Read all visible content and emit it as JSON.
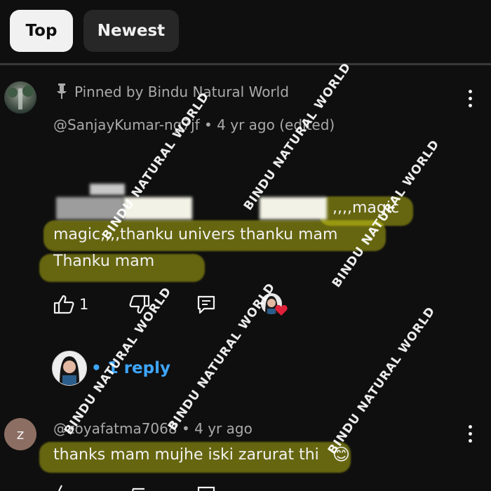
{
  "filters": {
    "top_label": "Top",
    "newest_label": "Newest"
  },
  "pinned_comment": {
    "pinned_label": "Pinned by Bindu Natural World",
    "author_meta": "@SanjayKumar-ng7jf • 4 yr ago (edited)",
    "line1_end": ",,,,magic",
    "line2": "magic,,,,thanku univers thanku mam",
    "line3": "Thanku mam",
    "like_count": "1",
    "reply_link": "• 1 reply"
  },
  "second_comment": {
    "avatar_letter": "z",
    "author_meta": "@zoyafatma7068 • 4 yr ago",
    "text": "thanks mam mujhe iski zarurat thi",
    "emoji": "😊"
  },
  "watermark": "BINDU NATURAL WORLD",
  "colors": {
    "background": "#0f0f0f",
    "highlight": "#e0e014",
    "heart": "#e0213a",
    "link": "#3ea6ff"
  },
  "icons": [
    "pin-icon",
    "like-icon",
    "dislike-icon",
    "reply-icon",
    "heart-icon",
    "more-vert-icon"
  ]
}
